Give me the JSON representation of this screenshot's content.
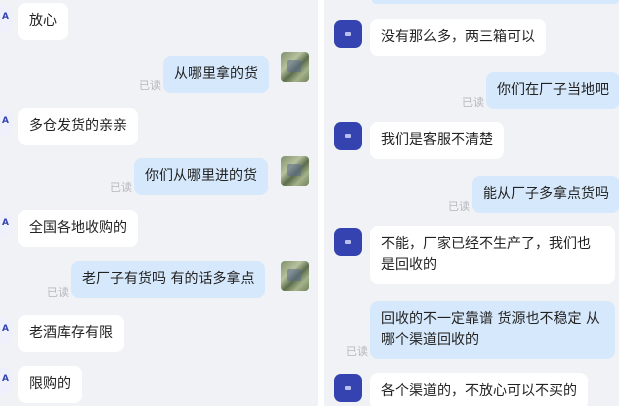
{
  "read_label": "已读",
  "left_chat": {
    "messages": [
      {
        "text": "放心"
      },
      {
        "text": "从哪里拿的货"
      },
      {
        "text": "多仓发货的亲亲"
      },
      {
        "text": "你们从哪里进的货"
      },
      {
        "text": "全国各地收购的"
      },
      {
        "text": "老厂子有货吗 有的话多拿点"
      },
      {
        "text": "老酒库存有限"
      },
      {
        "text": "限购的"
      }
    ]
  },
  "right_chat": {
    "messages": [
      {
        "text": "没有那么多，两三箱可以"
      },
      {
        "text": "你们在厂子当地吧"
      },
      {
        "text": "我们是客服不清楚"
      },
      {
        "text": "能从厂子多拿点货吗"
      },
      {
        "text": "不能，厂家已经不生产了，我们也是回收的"
      },
      {
        "text": "回收的不一定靠谱 货源也不稳定 从哪个渠道回收的"
      },
      {
        "text": "各个渠道的，不放心可以不买的"
      }
    ]
  }
}
